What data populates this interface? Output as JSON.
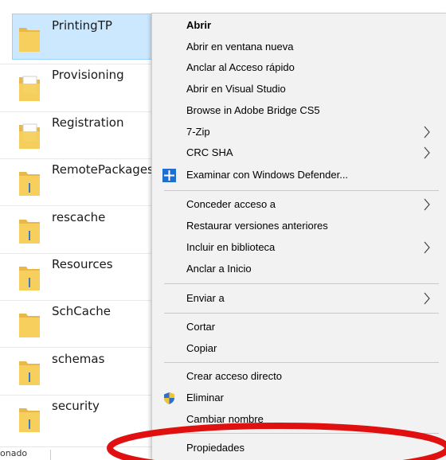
{
  "explorer": {
    "files": [
      {
        "name": "PrintingTP",
        "icon": "folder-icon",
        "selected": true
      },
      {
        "name": "Provisioning",
        "icon": "folder-doc-icon"
      },
      {
        "name": "Registration",
        "icon": "folder-doc-icon"
      },
      {
        "name": "RemotePackages",
        "icon": "folder-zip-icon"
      },
      {
        "name": "rescache",
        "icon": "folder-zip-icon"
      },
      {
        "name": "Resources",
        "icon": "folder-zip-icon"
      },
      {
        "name": "SchCache",
        "icon": "folder-icon"
      },
      {
        "name": "schemas",
        "icon": "folder-zip-icon"
      },
      {
        "name": "security",
        "icon": "folder-zip-icon"
      }
    ],
    "status_text": "onado"
  },
  "context_menu": {
    "items": [
      {
        "label": "Abrir",
        "bold": true
      },
      {
        "label": "Abrir en ventana nueva"
      },
      {
        "label": "Anclar al Acceso rápido"
      },
      {
        "label": "Abrir en Visual Studio"
      },
      {
        "label": "Browse in Adobe Bridge CS5"
      },
      {
        "label": "7-Zip",
        "submenu": true
      },
      {
        "label": "CRC SHA",
        "submenu": true
      },
      {
        "label": "Examinar con Windows Defender...",
        "icon": "windows-defender-icon"
      },
      {
        "label": "Conceder acceso a",
        "submenu": true
      },
      {
        "label": "Restaurar versiones anteriores"
      },
      {
        "label": "Incluir en biblioteca",
        "submenu": true
      },
      {
        "label": "Anclar a Inicio"
      },
      {
        "label": "Enviar a",
        "submenu": true
      },
      {
        "label": "Cortar"
      },
      {
        "label": "Copiar"
      },
      {
        "label": "Crear acceso directo"
      },
      {
        "label": "Eliminar",
        "icon": "shield-icon"
      },
      {
        "label": "Cambiar nombre"
      },
      {
        "label": "Propiedades",
        "highlighted": true
      }
    ]
  },
  "colors": {
    "selection": "#cce8ff",
    "menu_background": "#f2f2f2",
    "highlight_ellipse": "#e01010",
    "folder_yellow": "#f3c64d"
  }
}
